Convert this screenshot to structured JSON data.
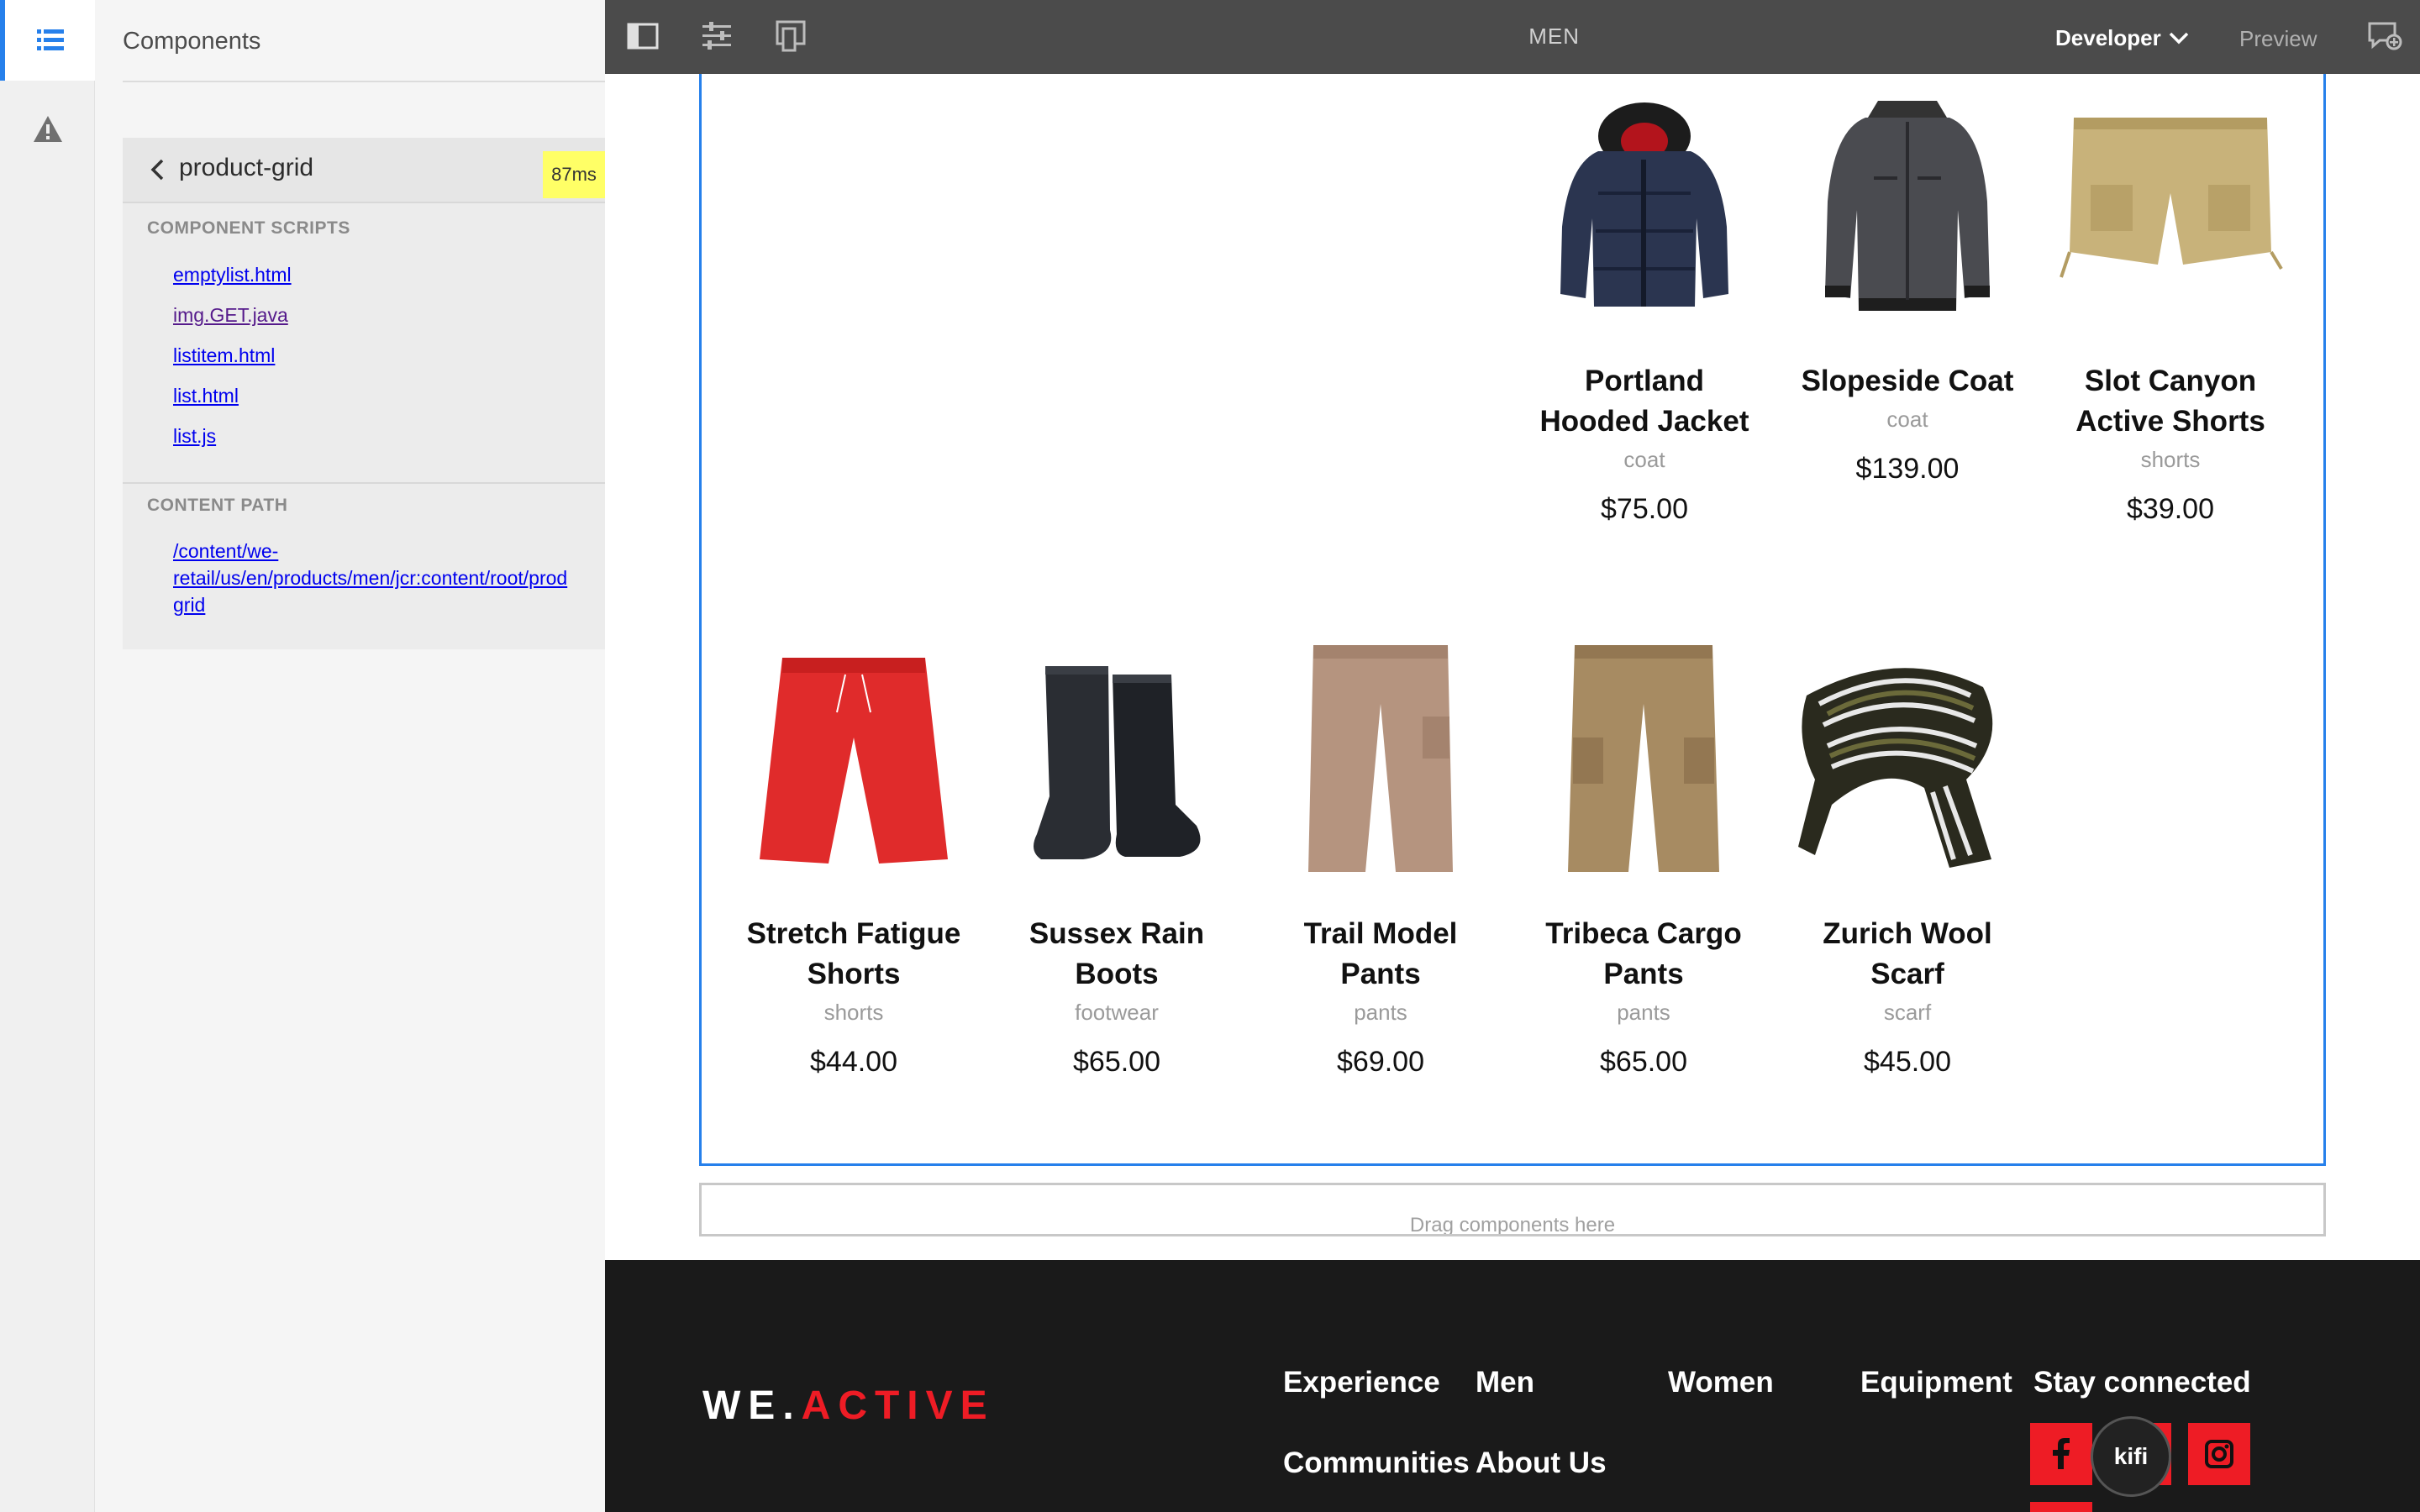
{
  "rail": {
    "components_icon": "list-icon",
    "warning_icon": "warning-icon"
  },
  "panel": {
    "title": "Components",
    "component": {
      "name": "product-grid",
      "timing": "87ms",
      "scripts_label": "COMPONENT SCRIPTS",
      "scripts": [
        "emptylist.html",
        "img.GET.java",
        "listitem.html",
        "list.html",
        "list.js"
      ],
      "content_path_label": "CONTENT PATH",
      "content_path_lines": [
        "/content/we-",
        "retail/us/en/products/men/jcr:content/root/prod",
        "grid"
      ]
    }
  },
  "toolbar": {
    "title": "MEN",
    "role": "Developer",
    "preview": "Preview",
    "icons": [
      "side-panel-icon",
      "properties-icon",
      "emulator-icon",
      "annotations-icon"
    ]
  },
  "products": [
    {
      "name": "Portland Hooded Jacket",
      "name_lines": [
        "Portland",
        "Hooded Jacket"
      ],
      "type": "coat",
      "price": "$75.00"
    },
    {
      "name": "Slopeside Coat",
      "name_lines": [
        "Slopeside Coat"
      ],
      "type": "coat",
      "price": "$139.00"
    },
    {
      "name": "Slot Canyon Active Shorts",
      "name_lines": [
        "Slot Canyon",
        "Active Shorts"
      ],
      "type": "shorts",
      "price": "$39.00"
    },
    {
      "name": "Stretch Fatigue Shorts",
      "name_lines": [
        "Stretch Fatigue",
        "Shorts"
      ],
      "type": "shorts",
      "price": "$44.00"
    },
    {
      "name": "Sussex Rain Boots",
      "name_lines": [
        "Sussex Rain",
        "Boots"
      ],
      "type": "footwear",
      "price": "$65.00"
    },
    {
      "name": "Trail Model Pants",
      "name_lines": [
        "Trail Model",
        "Pants"
      ],
      "type": "pants",
      "price": "$69.00"
    },
    {
      "name": "Tribeca Cargo Pants",
      "name_lines": [
        "Tribeca Cargo",
        "Pants"
      ],
      "type": "pants",
      "price": "$65.00"
    },
    {
      "name": "Zurich Wool Scarf",
      "name_lines": [
        "Zurich Wool",
        "Scarf"
      ],
      "type": "scarf",
      "price": "$45.00"
    }
  ],
  "drop_zone": "Drag components here",
  "footer": {
    "logo_main": "WE.",
    "logo_accent": "ACTIVE",
    "nav": [
      "Experience",
      "Men",
      "Women",
      "Equipment",
      "Communities",
      "About Us"
    ],
    "stay_connected": "Stay connected",
    "social_icons": [
      "facebook-icon",
      "twitter-icon",
      "instagram-icon"
    ],
    "kifi": "kifi"
  },
  "colors": {
    "accent_blue": "#2680eb",
    "brand_red": "#ee1c25",
    "toolbar": "#4b4b4b",
    "footer": "#1a1a1a",
    "timing_badge": "#ffff66"
  }
}
